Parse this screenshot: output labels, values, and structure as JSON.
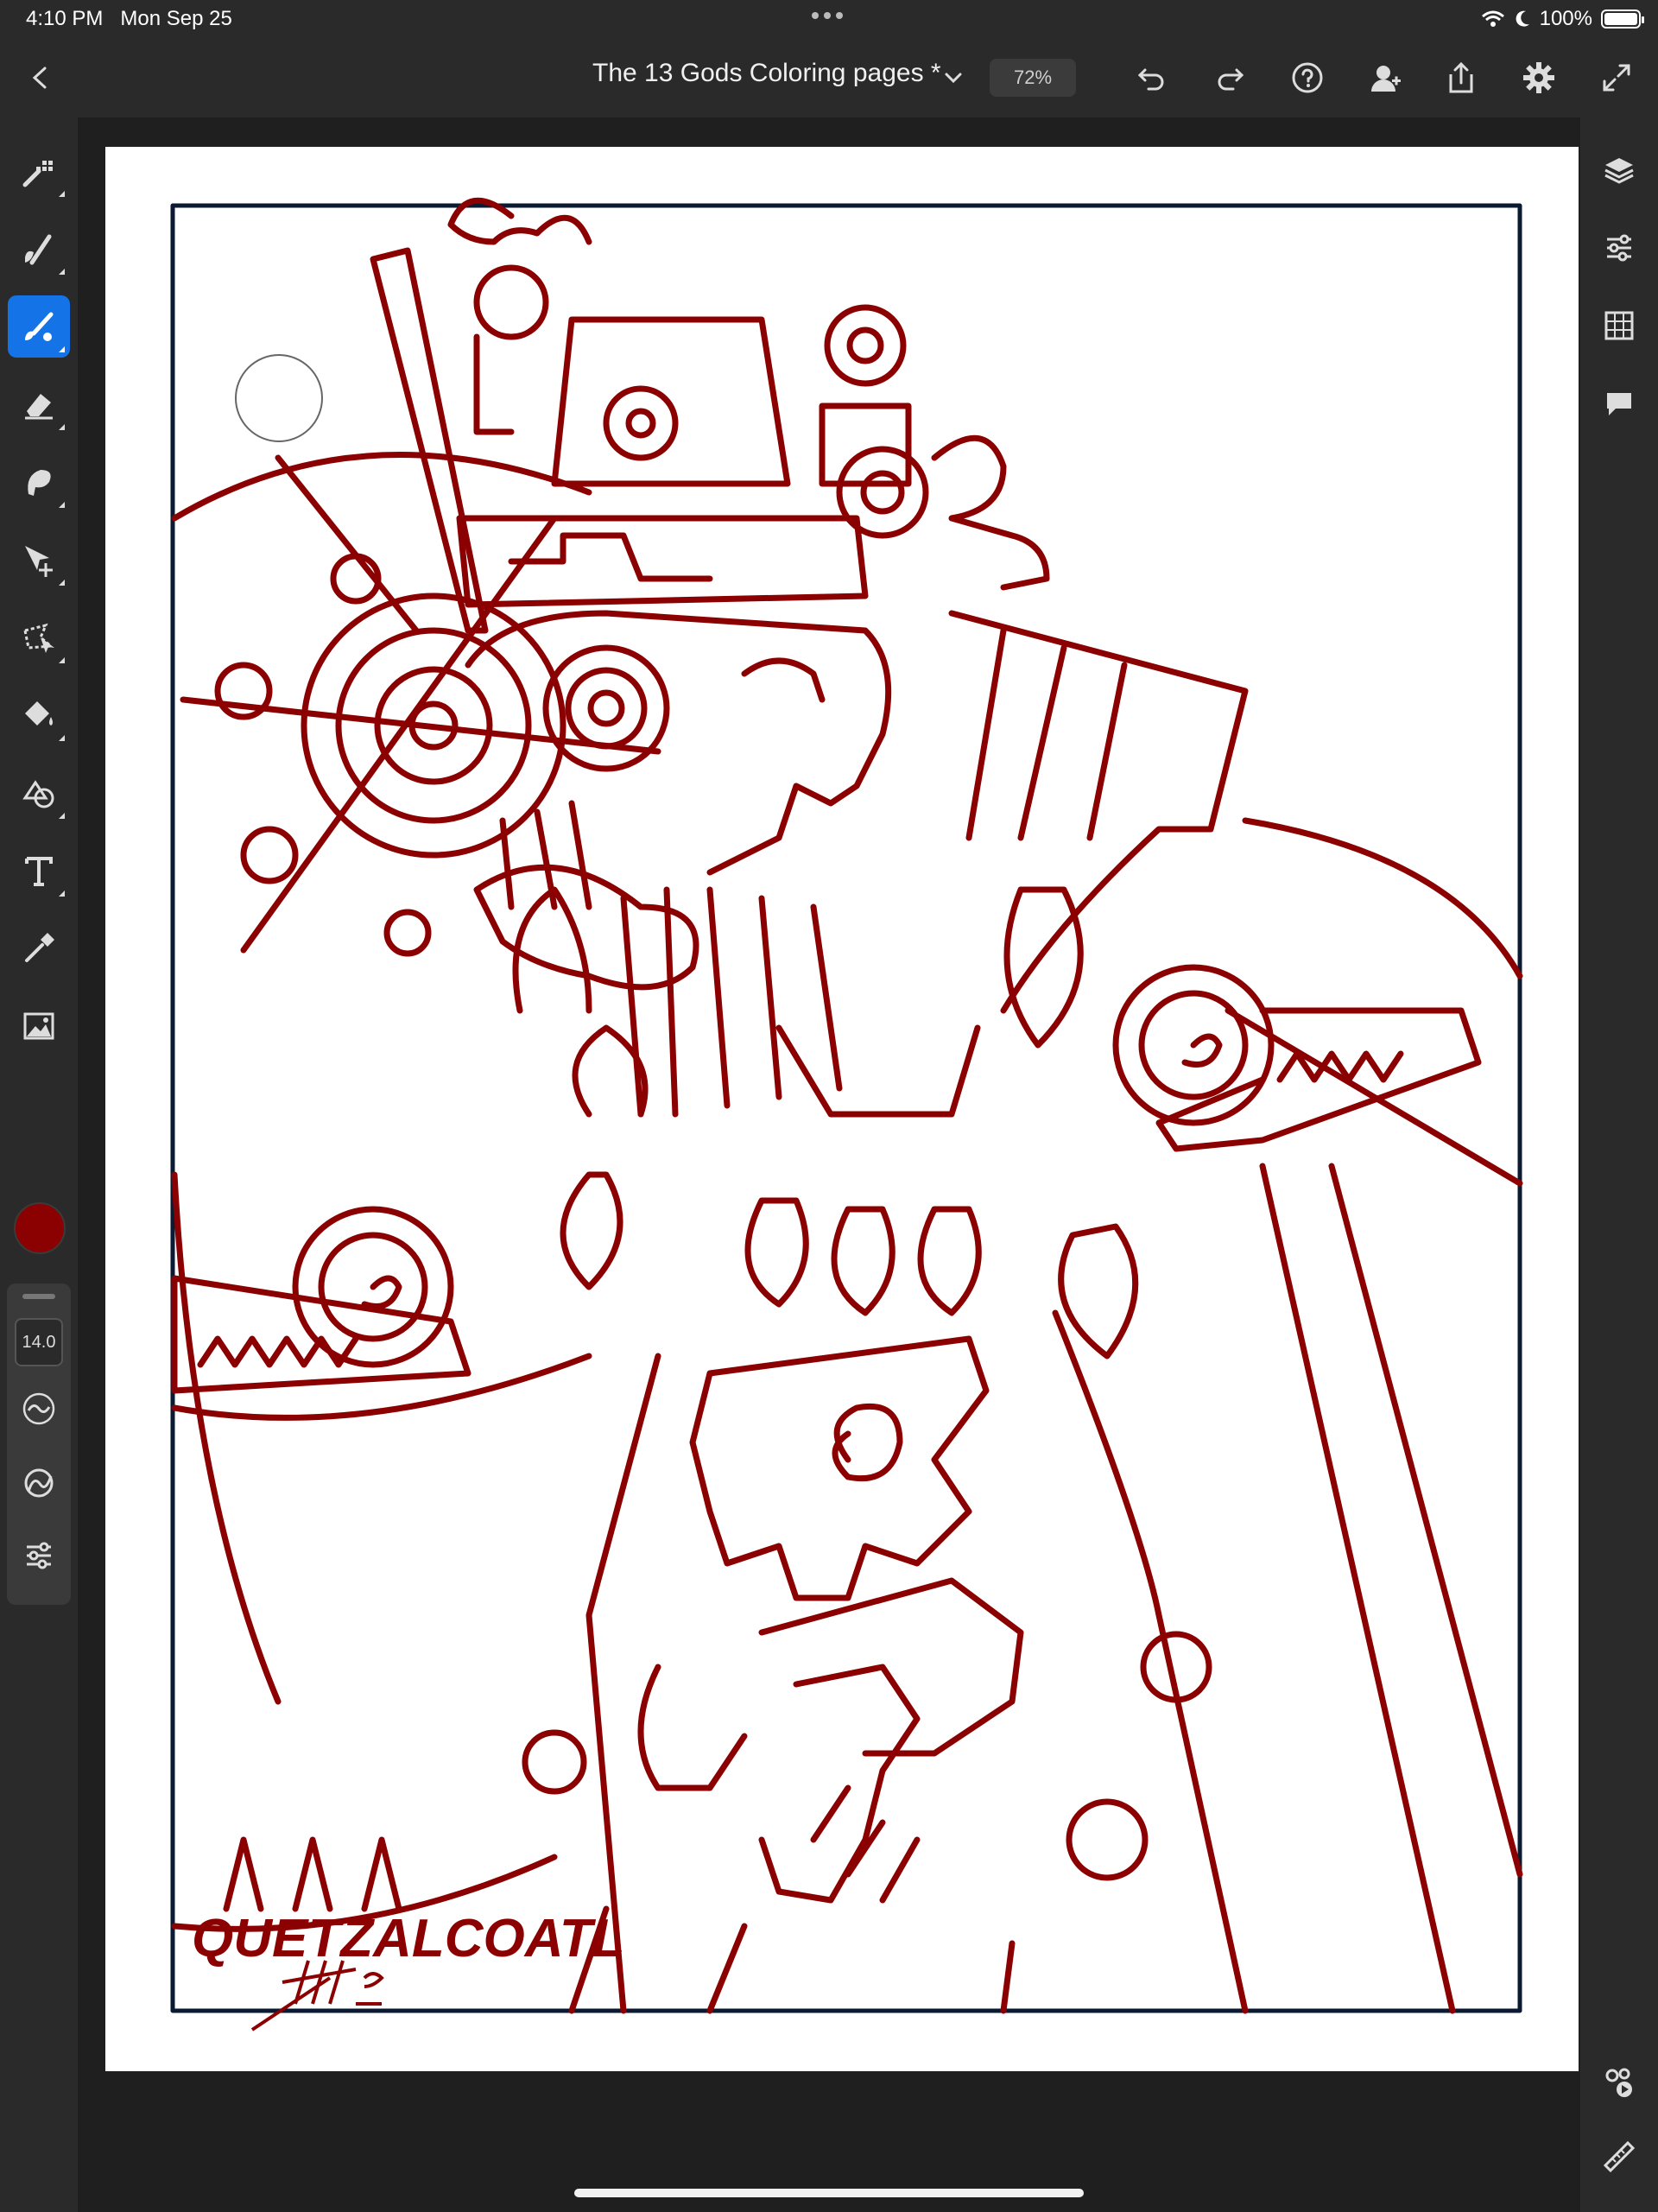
{
  "status_bar": {
    "time": "4:10 PM",
    "date": "Mon Sep 25",
    "battery": "100%",
    "battery_level": 1.0
  },
  "topbar": {
    "title": "The 13 Gods Coloring pages *",
    "zoom": "72%",
    "icons": [
      "back-chevron-icon",
      "title-dropdown-icon",
      "undo-icon",
      "redo-icon",
      "help-icon",
      "invite-icon",
      "share-icon",
      "settings-gear-icon",
      "fullscreen-icon"
    ]
  },
  "left_toolbar": {
    "tools": [
      "pixel-brush-icon",
      "live-brush-icon",
      "vector-brush-icon",
      "eraser-icon",
      "smudge-icon",
      "move-transform-icon",
      "lasso-select-icon",
      "fill-bucket-icon",
      "shape-icon",
      "text-icon",
      "eyedropper-icon",
      "image-place-icon"
    ],
    "active_tool": "vector-brush-icon",
    "current_color": "#8b0000",
    "brush_size": "14.0"
  },
  "right_toolbar": {
    "icons": [
      "layers-icon",
      "properties-icon",
      "grid-icon",
      "comments-icon",
      "tutorials-icon",
      "ruler-icon"
    ]
  },
  "canvas": {
    "artwork_signature": "QUETZALCOATL",
    "line_color": "#8b0000",
    "frame_color": "#0b1a33"
  },
  "colors": {
    "accent": "#1473e6",
    "ui_background": "#2a2a2a"
  }
}
